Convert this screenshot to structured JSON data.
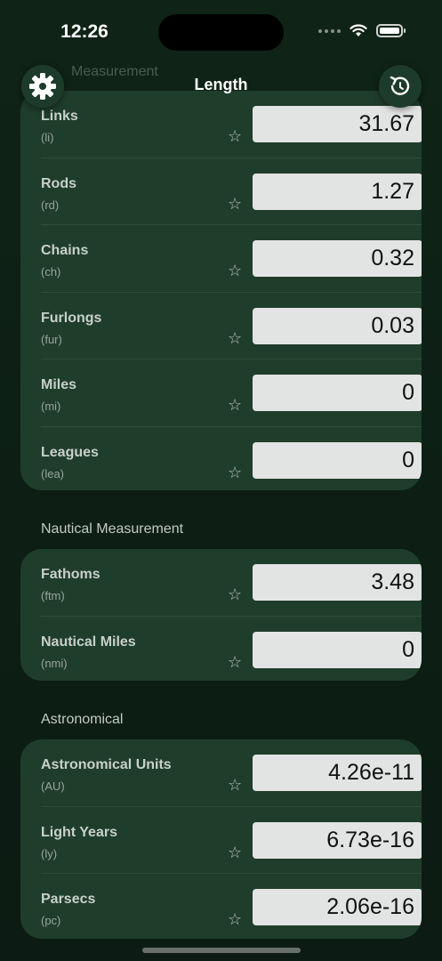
{
  "status": {
    "time": "12:26"
  },
  "header": {
    "title": "Length",
    "ghost_section": "Measurement",
    "settings_icon": "gear-icon",
    "reset_icon": "rotate-ccw-icon"
  },
  "sections": [
    {
      "label": "",
      "rows": [
        {
          "name": "Links",
          "abbr": "(li)",
          "value": "31.67"
        },
        {
          "name": "Rods",
          "abbr": "(rd)",
          "value": "1.27"
        },
        {
          "name": "Chains",
          "abbr": "(ch)",
          "value": "0.32"
        },
        {
          "name": "Furlongs",
          "abbr": "(fur)",
          "value": "0.03"
        },
        {
          "name": "Miles",
          "abbr": "(mi)",
          "value": "0"
        },
        {
          "name": "Leagues",
          "abbr": "(lea)",
          "value": "0"
        }
      ]
    },
    {
      "label": "Nautical Measurement",
      "rows": [
        {
          "name": "Fathoms",
          "abbr": "(ftm)",
          "value": "3.48"
        },
        {
          "name": "Nautical Miles",
          "abbr": "(nmi)",
          "value": "0"
        }
      ]
    },
    {
      "label": "Astronomical",
      "rows": [
        {
          "name": "Astronomical Units",
          "abbr": "(AU)",
          "value": "4.26e-11"
        },
        {
          "name": "Light Years",
          "abbr": "(ly)",
          "value": "6.73e-16"
        },
        {
          "name": "Parsecs",
          "abbr": "(pc)",
          "value": "2.06e-16"
        }
      ]
    }
  ],
  "colors": {
    "background": "#0d1f15",
    "card": "#1f3d2b",
    "field": "#e2e4e3"
  }
}
